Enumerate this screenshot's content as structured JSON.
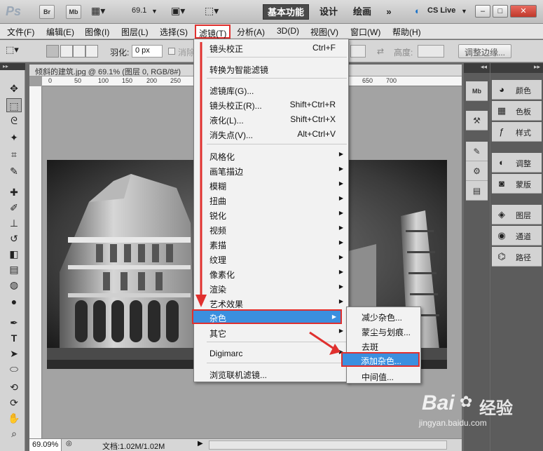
{
  "appbar": {
    "logo": "Ps",
    "bridge_btn": "Br",
    "minibridge_btn": "Mb",
    "zoom_value": "69.1",
    "workspaces": [
      "基本功能",
      "设计",
      "绘画"
    ],
    "more": "»",
    "cslive": "CS Live",
    "window_controls": [
      "–",
      "□",
      "✕"
    ]
  },
  "menubar": {
    "items": [
      "文件(F)",
      "编辑(E)",
      "图像(I)",
      "图层(L)",
      "选择(S)",
      "滤镜(T)",
      "分析(A)",
      "3D(D)",
      "视图(V)",
      "窗口(W)",
      "帮助(H)"
    ]
  },
  "options": {
    "feather_label": "羽化:",
    "feather_value": "0 px",
    "antialias_label": "消除",
    "height_label": "高度:",
    "refine_edge": "调整边缘..."
  },
  "document": {
    "tab_title": "倾斜的建筑.jpg @ 69.1% (图层 0, RGB/8#)",
    "ruler_ticks": [
      "0",
      "50",
      "100",
      "150",
      "200",
      "250",
      "650",
      "700"
    ],
    "zoom": "69.09%",
    "doc_info": "文档:1.02M/1.02M"
  },
  "filter_menu": {
    "last_filter": "镜头校正",
    "last_filter_shortcut": "Ctrl+F",
    "convert_smart": "转换为智能滤镜",
    "items_group1": [
      {
        "label": "滤镜库(G)...",
        "shortcut": ""
      },
      {
        "label": "镜头校正(R)...",
        "shortcut": "Shift+Ctrl+R"
      },
      {
        "label": "液化(L)...",
        "shortcut": "Shift+Ctrl+X"
      },
      {
        "label": "消失点(V)...",
        "shortcut": "Alt+Ctrl+V"
      }
    ],
    "items_group2": [
      "风格化",
      "画笔描边",
      "模糊",
      "扭曲",
      "锐化",
      "视频",
      "素描",
      "纹理",
      "像素化",
      "渲染",
      "艺术效果",
      "杂色",
      "其它"
    ],
    "digimarc": "Digimarc",
    "browse_online": "浏览联机滤镜..."
  },
  "noise_submenu": {
    "items": [
      "减少杂色...",
      "蒙尘与划痕...",
      "去斑",
      "添加杂色...",
      "中间值..."
    ]
  },
  "panels": {
    "group1": [
      "颜色",
      "色板",
      "样式"
    ],
    "group2": [
      "调整",
      "蒙版"
    ],
    "group3": [
      "图层",
      "通道",
      "路径"
    ],
    "narrow_icons": [
      "Mb",
      "⚒",
      "✎",
      "⚙",
      "▤"
    ]
  },
  "watermark": {
    "brand": "Bai",
    "brand2": "经验",
    "url": "jingyan.baidu.com"
  },
  "colors": {
    "highlight": "#3b8fdf",
    "annotation_red": "#e0302e"
  }
}
